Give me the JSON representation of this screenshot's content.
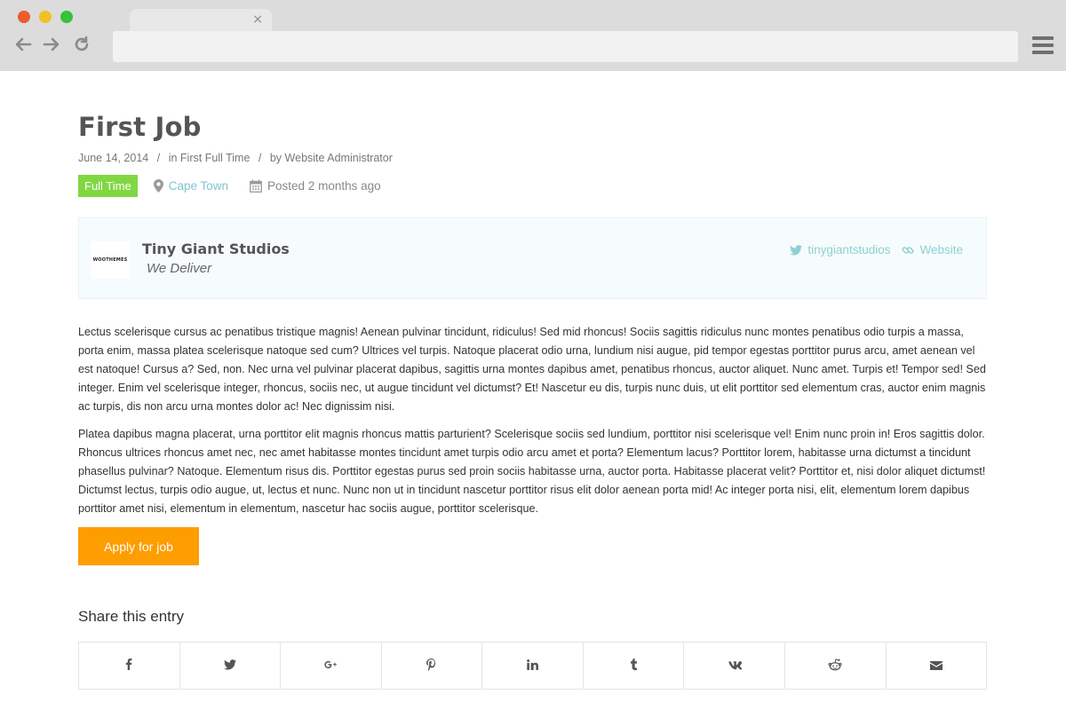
{
  "browser": {
    "tab_close": "×",
    "url": "",
    "icons": [
      "back-arrow-icon",
      "forward-arrow-icon",
      "reload-icon",
      "hamburger-menu-icon"
    ]
  },
  "job": {
    "title": "First Job",
    "date": "June 14, 2014",
    "category_prefix": "in",
    "category": "First Full Time",
    "author_prefix": "by",
    "author": "Website Administrator",
    "type_badge": "Full Time",
    "location": "Cape Town",
    "posted": "Posted 2 months ago"
  },
  "company": {
    "logo_text": "WOOTHEMES",
    "name": "Tiny Giant Studios",
    "tagline": "We Deliver",
    "twitter": "tinygiantstudios",
    "website": "Website"
  },
  "description": [
    "Lectus scelerisque cursus ac penatibus tristique magnis! Aenean pulvinar tincidunt, ridiculus! Sed mid rhoncus! Sociis sagittis ridiculus nunc montes penatibus odio turpis a massa, porta enim, massa platea scelerisque natoque sed cum? Ultrices vel turpis. Natoque placerat odio urna, lundium nisi augue, pid tempor egestas porttitor purus arcu, amet aenean vel est natoque! Cursus a? Sed, non. Nec urna vel pulvinar placerat dapibus, sagittis urna montes dapibus amet, penatibus rhoncus, auctor aliquet. Nunc amet. Turpis et! Tempor sed! Sed integer. Enim vel scelerisque integer, rhoncus, sociis nec, ut augue tincidunt vel dictumst? Et! Nascetur eu dis, turpis nunc duis, ut elit porttitor sed elementum cras, auctor enim magnis ac turpis, dis non arcu urna montes dolor ac! Nec dignissim nisi.",
    "Platea dapibus magna placerat, urna porttitor elit magnis rhoncus mattis parturient? Scelerisque sociis sed lundium, porttitor nisi scelerisque vel! Enim nunc proin in! Eros sagittis dolor. Rhoncus ultrices rhoncus amet nec, nec amet habitasse montes tincidunt amet turpis odio arcu amet et porta? Elementum lacus? Porttitor lorem, habitasse urna dictumst a tincidunt phasellus pulvinar? Natoque. Elementum risus dis. Porttitor egestas purus sed proin sociis habitasse urna, auctor porta. Habitasse placerat velit? Porttitor et, nisi dolor aliquet dictumst! Dictumst lectus, turpis odio augue, ut, lectus et nunc. Nunc non ut in tincidunt nascetur porttitor risus elit dolor aenean porta mid! Ac integer porta nisi, elit, elementum lorem dapibus porttitor amet nisi, elementum in elementum, nascetur hac sociis augue, porttitor scelerisque."
  ],
  "apply_label": "Apply for job",
  "share": {
    "title": "Share this entry",
    "items": [
      {
        "name": "facebook-icon",
        "glyph": "f"
      },
      {
        "name": "twitter-icon",
        "glyph": "🐦"
      },
      {
        "name": "google-plus-icon",
        "glyph": "g+"
      },
      {
        "name": "pinterest-icon",
        "glyph": "p"
      },
      {
        "name": "linkedin-icon",
        "glyph": "in"
      },
      {
        "name": "tumblr-icon",
        "glyph": "t"
      },
      {
        "name": "vk-icon",
        "glyph": "vk"
      },
      {
        "name": "reddit-icon",
        "glyph": "reddit"
      },
      {
        "name": "mail-icon",
        "glyph": "✉"
      }
    ]
  },
  "colors": {
    "badge": "#81d742",
    "accent_link": "#7ec6ce",
    "apply_button": "#fd9d00",
    "company_box_bg": "#f6fcfd"
  }
}
